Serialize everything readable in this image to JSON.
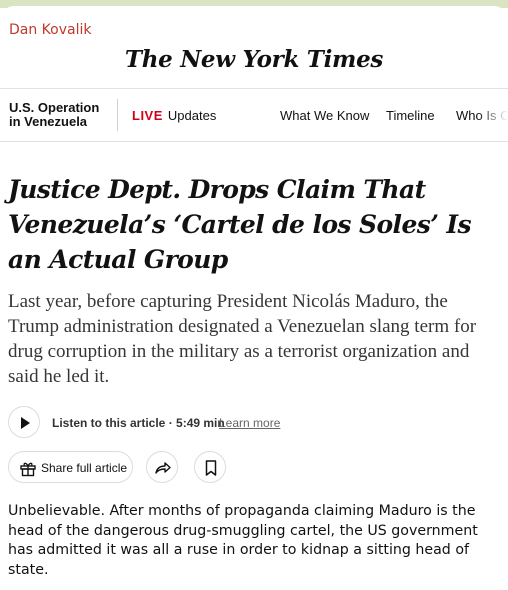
{
  "message": {
    "sender": "Dan Kovalik",
    "comment": "Unbelievable. After months of propaganda claiming Maduro is the head of the dangerous drug-smuggling cartel, the US government has admitted it was all a ruse in order to kidnap a sitting head of state."
  },
  "site": {
    "masthead": "The New York Times"
  },
  "nav": {
    "section_line1": "U.S. Operation",
    "section_line2": "in Venezuela",
    "live_badge": "LIVE",
    "live_label": "Updates",
    "links": [
      "What We Know",
      "Timeline",
      "Who Is C"
    ]
  },
  "article": {
    "headline": "Justice Dept. Drops Claim That Venezuela’s ‘Cartel de los Soles’ Is an Actual Group",
    "summary": "Last year, before capturing President Nicolás Maduro, the Trump administration designated a Venezuelan slang term for drug corruption in the military as a terrorist organization and said he led it.",
    "listen_label": "Listen to this article · 5:49 min",
    "learn_more": "Learn more",
    "share_label": "Share full article"
  },
  "icons": {
    "play": "play-icon",
    "gift": "gift-icon",
    "share": "share-arrow-icon",
    "bookmark": "bookmark-icon"
  },
  "colors": {
    "sender": "#c0392b",
    "live": "#d0021b",
    "top_bar": "#d9e5c2"
  }
}
